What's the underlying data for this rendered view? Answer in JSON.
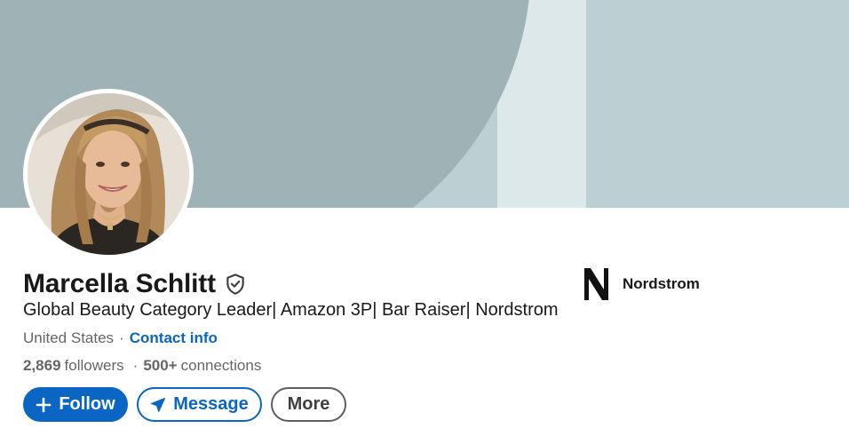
{
  "profile": {
    "name": "Marcella Schlitt",
    "headline": "Global Beauty Category Leader| Amazon 3P| Bar Raiser| Nordstrom",
    "location": "United States",
    "location_separator": "·",
    "contact_info_label": "Contact info",
    "followers_count": "2,869",
    "followers_label": "followers",
    "connections_separator": "·",
    "connections_count": "500+",
    "connections_label": "connections"
  },
  "actions": {
    "follow_label": "Follow",
    "message_label": "Message",
    "more_label": "More"
  },
  "company": {
    "name": "Nordstrom",
    "logo_letter": "N"
  },
  "icons": {
    "verified": "shield-check-icon",
    "follow": "plus-icon",
    "message": "paper-plane-icon"
  },
  "colors": {
    "accent": "#0a66c2",
    "banner_main": "#bccfd3",
    "banner_arc": "#9fb3b7",
    "banner_pale": "#dde8ea",
    "text_primary": "#191919",
    "text_secondary": "#666666"
  }
}
